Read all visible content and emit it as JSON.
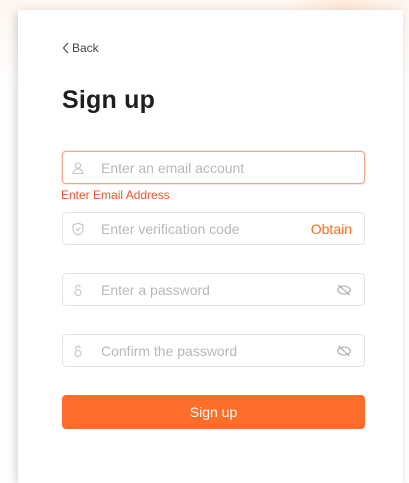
{
  "nav": {
    "back_label": "Back"
  },
  "page": {
    "title": "Sign up"
  },
  "form": {
    "email": {
      "value": "",
      "placeholder": "Enter an email account",
      "icon": "user-icon",
      "state": "error",
      "error_message": "Enter Email Address"
    },
    "verification": {
      "value": "",
      "placeholder": "Enter verification code",
      "icon": "shield-icon",
      "action_label": "Obtain"
    },
    "password": {
      "value": "",
      "placeholder": "Enter a password",
      "icon": "lock-icon",
      "toggle_icon": "eye-off-icon"
    },
    "confirm_password": {
      "value": "",
      "placeholder": "Confirm the password",
      "icon": "lock-icon",
      "toggle_icon": "eye-off-icon"
    },
    "submit_label": "Sign up"
  },
  "colors": {
    "accent": "#ff6d2b",
    "error_text": "#f0522c",
    "error_border": "#f3a48a",
    "placeholder": "#b8b8b8",
    "input_border": "#e4e4e4"
  }
}
